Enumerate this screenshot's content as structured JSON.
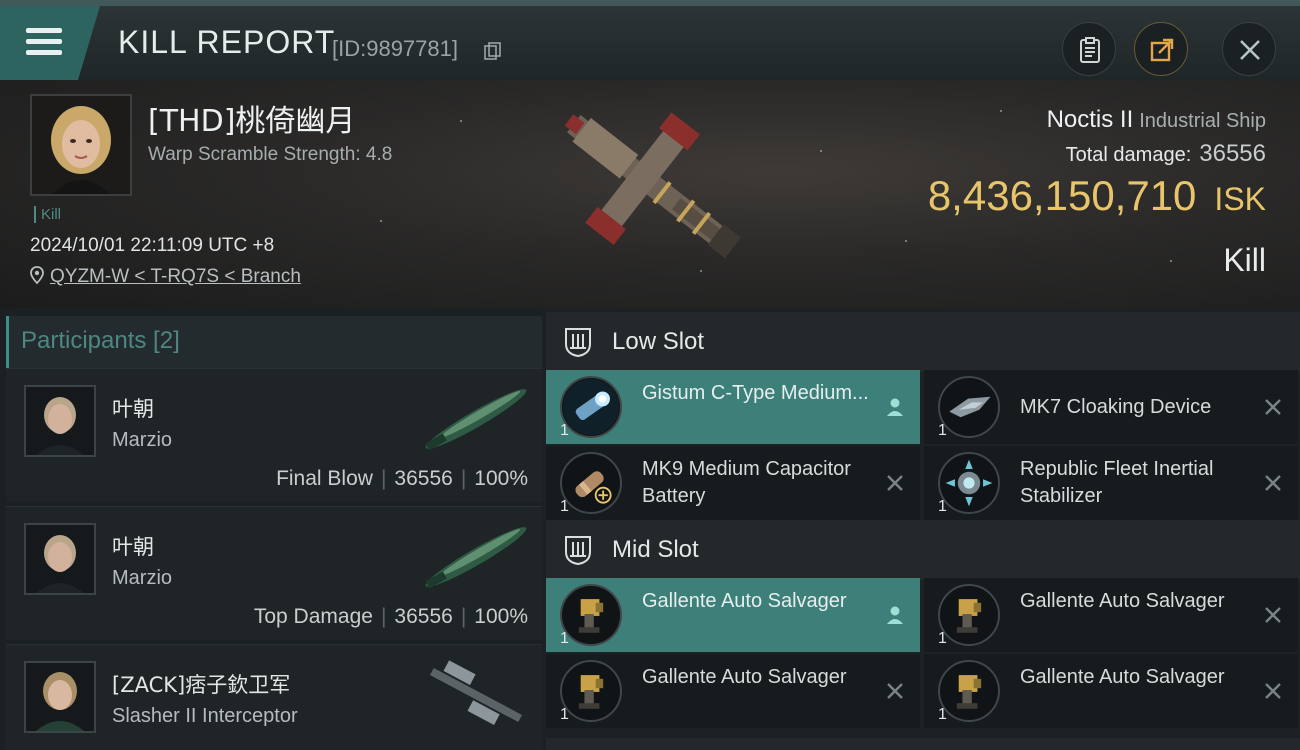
{
  "header": {
    "title": "KILL REPORT",
    "report_id": "[ID:9897781]"
  },
  "victim": {
    "name": "[THD]桃倚幽月",
    "scramble": "Warp Scramble Strength: 4.8",
    "tag": "Kill",
    "datetime": "2024/10/01 22:11:09 UTC +8",
    "location": "QYZM-W < T-RQ7S < Branch",
    "ship_name": "Noctis II",
    "ship_class": "Industrial Ship",
    "damage_label": "Total damage:",
    "damage_value": "36556",
    "isk_value": "8,436,150,710",
    "isk_unit": "ISK",
    "result": "Kill"
  },
  "participants": {
    "header": "Participants [2]",
    "rows": [
      {
        "name": "叶朝",
        "sub": "Marzio",
        "role": "Final Blow",
        "damage": "36556",
        "pct": "100%"
      },
      {
        "name": "叶朝",
        "sub": "Marzio",
        "role": "Top Damage",
        "damage": "36556",
        "pct": "100%"
      },
      {
        "name": "[ZACK]痞子欽卫军",
        "sub": "Slasher II Interceptor"
      }
    ]
  },
  "fitting": {
    "low_slot": {
      "label": "Low Slot",
      "modules": [
        {
          "name": "Gistum C-Type Medium...",
          "qty": "1",
          "icon": "armor-repairer-icon",
          "highlighted": true
        },
        {
          "name": "MK7 Cloaking Device",
          "qty": "1",
          "icon": "cloaking-device-icon",
          "highlighted": false
        },
        {
          "name": "MK9 Medium Capacitor Battery",
          "qty": "1",
          "icon": "capacitor-battery-icon",
          "highlighted": false
        },
        {
          "name": "Republic Fleet Inertial Stabilizer",
          "qty": "1",
          "icon": "inertial-stabilizer-icon",
          "highlighted": false
        }
      ]
    },
    "mid_slot": {
      "label": "Mid Slot",
      "modules": [
        {
          "name": "Gallente Auto Salvager",
          "qty": "1",
          "icon": "salvager-icon",
          "highlighted": true
        },
        {
          "name": "Gallente Auto Salvager",
          "qty": "1",
          "icon": "salvager-icon",
          "highlighted": false
        },
        {
          "name": "Gallente Auto Salvager",
          "qty": "1",
          "icon": "salvager-icon",
          "highlighted": false
        },
        {
          "name": "Gallente Auto Salvager",
          "qty": "1",
          "icon": "salvager-icon",
          "highlighted": false
        }
      ]
    }
  },
  "colors": {
    "accent_teal": "#3d7f79",
    "isk_gold": "#e8c56b",
    "background": "#15191b"
  }
}
